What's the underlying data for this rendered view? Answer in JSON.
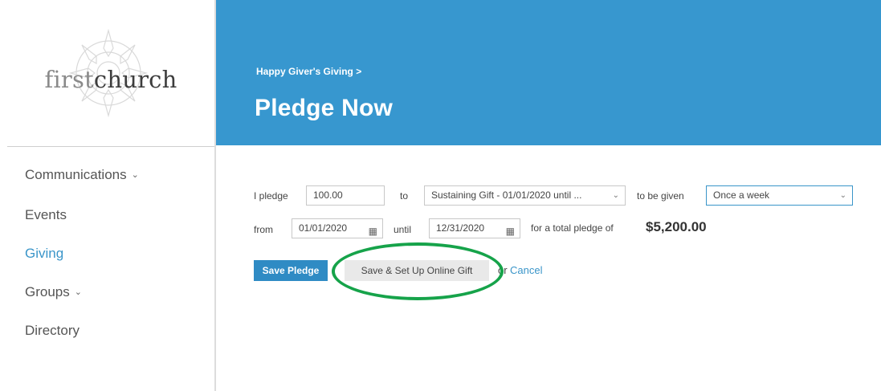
{
  "brand": {
    "logo_light": "first",
    "logo_bold": "church"
  },
  "sidebar": {
    "items": [
      {
        "label": "Communications",
        "has_dropdown": true,
        "active": false
      },
      {
        "label": "Events",
        "has_dropdown": false,
        "active": false
      },
      {
        "label": "Giving",
        "has_dropdown": false,
        "active": true
      },
      {
        "label": "Groups",
        "has_dropdown": true,
        "active": false
      },
      {
        "label": "Directory",
        "has_dropdown": false,
        "active": false
      }
    ]
  },
  "header": {
    "breadcrumb": "Happy Giver's Giving >",
    "title": "Pledge Now"
  },
  "form": {
    "pledge_label": "I pledge",
    "amount": "100.00",
    "to_label": "to",
    "fund": "Sustaining Gift - 01/01/2020 until ...",
    "given_label": "to be given",
    "frequency": "Once a week",
    "from_label": "from",
    "start_date": "01/01/2020",
    "until_label": "until",
    "end_date": "12/31/2020",
    "total_label": "for a total pledge of",
    "total": "$5,200.00",
    "save_label": "Save Pledge",
    "save_online_label": "Save & Set Up Online Gift",
    "or_text": "or",
    "cancel_label": "Cancel"
  },
  "icons": {
    "calendar": "calendar-icon",
    "chevron": "chevron-down-icon"
  },
  "colors": {
    "header_bg": "#3797cf",
    "accent": "#3a95c9",
    "primary_button": "#2f8bc4",
    "highlight": "#16a34a"
  }
}
